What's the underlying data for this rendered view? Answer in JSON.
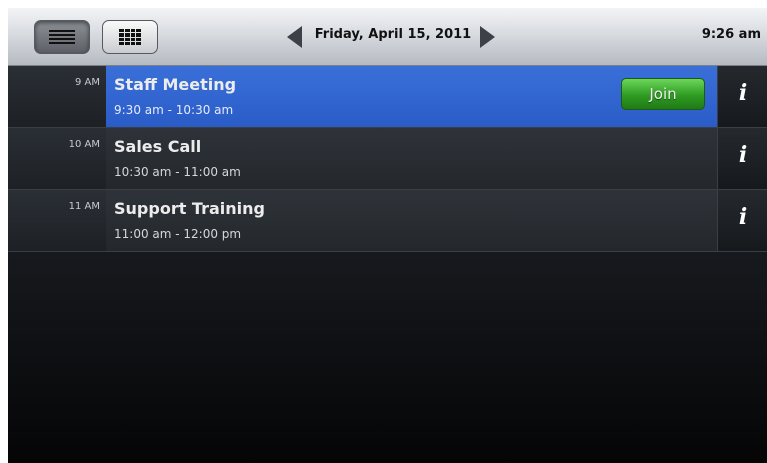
{
  "header": {
    "date": "Friday, April 15, 2011",
    "time": "9:26 am"
  },
  "view_buttons": {
    "list_icon": "list-icon",
    "grid_icon": "grid-icon",
    "active": "list"
  },
  "events": [
    {
      "hour": "9 AM",
      "title": "Staff Meeting",
      "time_range": "9:30 am - 10:30 am",
      "join_label": "Join",
      "info": "i",
      "active": true
    },
    {
      "hour": "10 AM",
      "title": "Sales Call",
      "time_range": "10:30 am - 11:00 am",
      "info": "i",
      "active": false
    },
    {
      "hour": "11 AM",
      "title": "Support Training",
      "time_range": "11:00 am - 12:00 pm",
      "info": "i",
      "active": false
    }
  ],
  "colors": {
    "active_row": "#3a6fd8",
    "join_button": "#2f9b22"
  }
}
